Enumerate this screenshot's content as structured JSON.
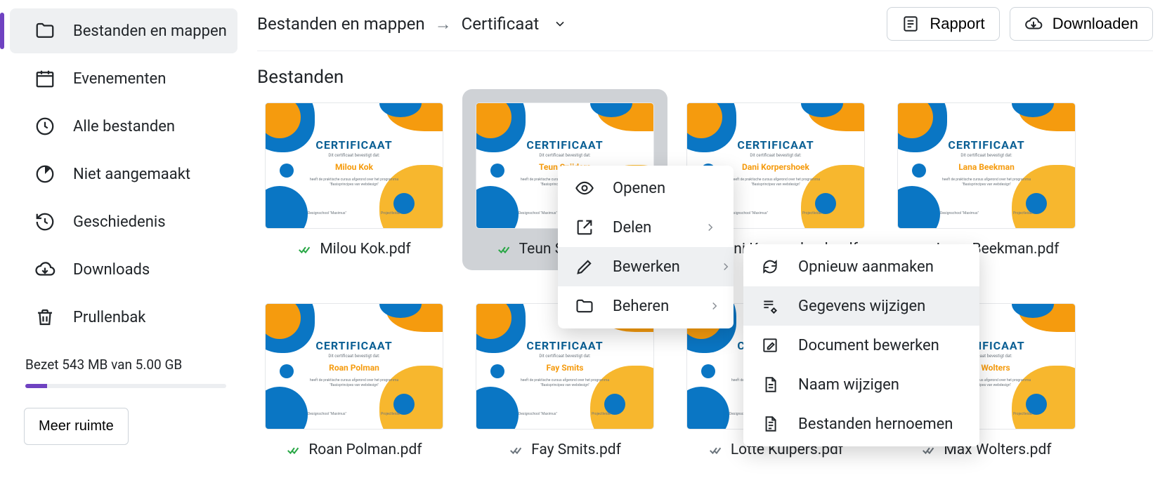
{
  "sidebar": {
    "items": [
      {
        "label": "Bestanden en mappen"
      },
      {
        "label": "Evenementen"
      },
      {
        "label": "Alle bestanden"
      },
      {
        "label": "Niet aangemaakt"
      },
      {
        "label": "Geschiedenis"
      },
      {
        "label": "Downloads"
      },
      {
        "label": "Prullenbak"
      }
    ],
    "storage_text": "Bezet 543 MB van 5.00 GB",
    "more_label": "Meer ruimte"
  },
  "breadcrumb": {
    "root": "Bestanden en mappen",
    "current": "Certificaat"
  },
  "top_buttons": {
    "report": "Rapport",
    "download": "Downloaden"
  },
  "section_title": "Bestanden",
  "cert_title": "CERTIFICAAT",
  "cert_sub": "Dit certificaat bevestigt dat:",
  "cert_desc1": "heeft de praktische cursus afgerond over het programma",
  "cert_desc2": "\"Basisprincipes van webdesign\"",
  "cert_foot_l": "Designschool \"Maximus\"",
  "cert_foot_r": "Projectleider",
  "files": [
    {
      "name": "Milou Kok",
      "file": "Milou Kok.pdf",
      "status": "ok"
    },
    {
      "name": "Teun Snijders",
      "file": "Teun Snijders.pdf",
      "status": "ok",
      "selected": true
    },
    {
      "name": "Dani Korpershoek",
      "file": "Dani Korpershoek.pdf",
      "status": "pending"
    },
    {
      "name": "Lana Beekman",
      "file": "Lana Beekman.pdf",
      "status": "error"
    },
    {
      "name": "Roan Polman",
      "file": "Roan Polman.pdf",
      "status": "ok"
    },
    {
      "name": "Fay Smits",
      "file": "Fay Smits.pdf",
      "status": "pending"
    },
    {
      "name": "Lotte Kuipers",
      "file": "Lotte Kuipers.pdf",
      "status": "pending"
    },
    {
      "name": "Max Wolters",
      "file": "Max Wolters.pdf",
      "status": "pending"
    }
  ],
  "ctx1": {
    "open": "Openen",
    "share": "Delen",
    "edit": "Bewerken",
    "manage": "Beheren"
  },
  "ctx2": {
    "recreate": "Opnieuw aanmaken",
    "change_data": "Gegevens wijzigen",
    "edit_doc": "Document bewerken",
    "rename": "Naam wijzigen",
    "rename_files": "Bestanden hernoemen"
  }
}
